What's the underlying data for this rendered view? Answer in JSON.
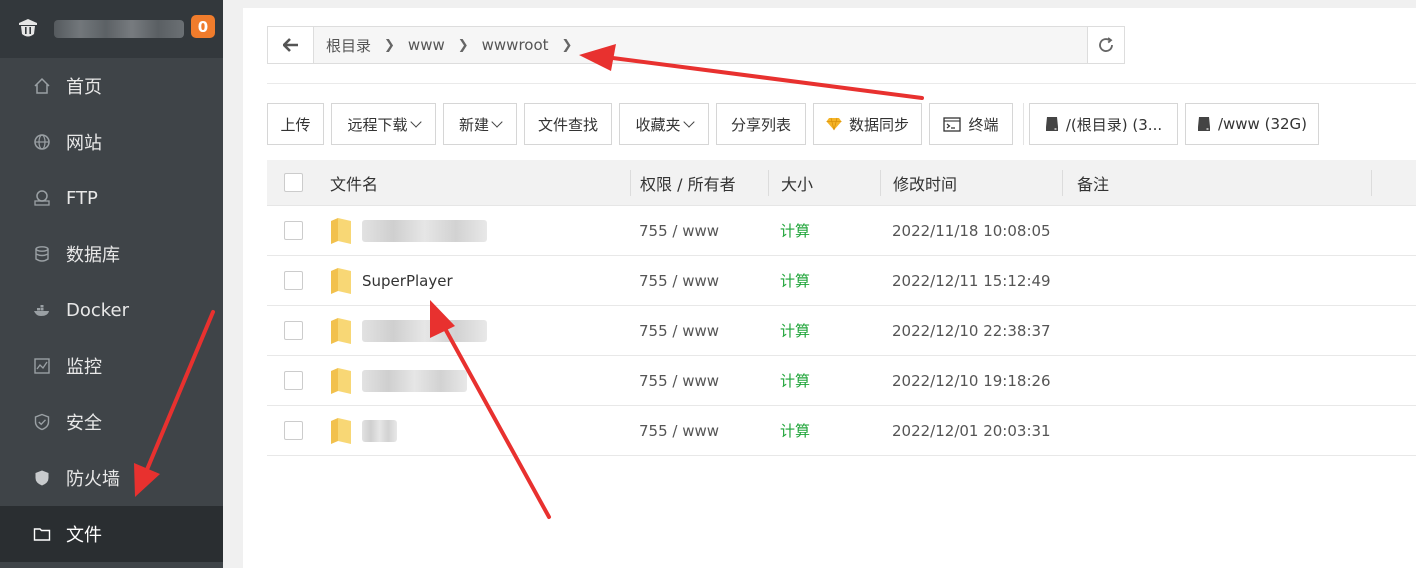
{
  "sidebar": {
    "badge_count": "0",
    "items": [
      {
        "label": "首页",
        "icon": "home-icon"
      },
      {
        "label": "网站",
        "icon": "globe-icon"
      },
      {
        "label": "FTP",
        "icon": "ftp-icon"
      },
      {
        "label": "数据库",
        "icon": "database-icon"
      },
      {
        "label": "Docker",
        "icon": "docker-icon"
      },
      {
        "label": "监控",
        "icon": "monitor-icon"
      },
      {
        "label": "安全",
        "icon": "shield-check-icon"
      },
      {
        "label": "防火墙",
        "icon": "firewall-shield-icon"
      },
      {
        "label": "文件",
        "icon": "folder-icon",
        "active": true
      }
    ]
  },
  "path": {
    "crumbs": [
      "根目录",
      "www",
      "wwwroot"
    ]
  },
  "toolbar": {
    "upload": "上传",
    "remote_download": "远程下载",
    "new": "新建",
    "file_search": "文件查找",
    "favorites": "收藏夹",
    "share_list": "分享列表",
    "data_sync": "数据同步",
    "terminal": "终端",
    "disk_root": "/(根目录) (3...",
    "disk_www": "/www (32G)"
  },
  "table": {
    "headers": {
      "name": "文件名",
      "perm": "权限 / 所有者",
      "size": "大小",
      "mtime": "修改时间",
      "note": "备注"
    },
    "rows": [
      {
        "name": "",
        "perm": "755 / www",
        "size": "计算",
        "mtime": "2022/11/18 10:08:05"
      },
      {
        "name": "SuperPlayer",
        "perm": "755 / www",
        "size": "计算",
        "mtime": "2022/12/11 15:12:49"
      },
      {
        "name": "",
        "perm": "755 / www",
        "size": "计算",
        "mtime": "2022/12/10 22:38:37"
      },
      {
        "name": "",
        "perm": "755 / www",
        "size": "计算",
        "mtime": "2022/12/10 19:18:26"
      },
      {
        "name": "",
        "perm": "755 / www",
        "size": "计算",
        "mtime": "2022/12/01 20:03:31"
      }
    ]
  },
  "colors": {
    "sidebar_bg": "#3f4448",
    "accent_green": "#20a53a",
    "badge_orange": "#f07c2c",
    "annotation_red": "#e8312f"
  }
}
